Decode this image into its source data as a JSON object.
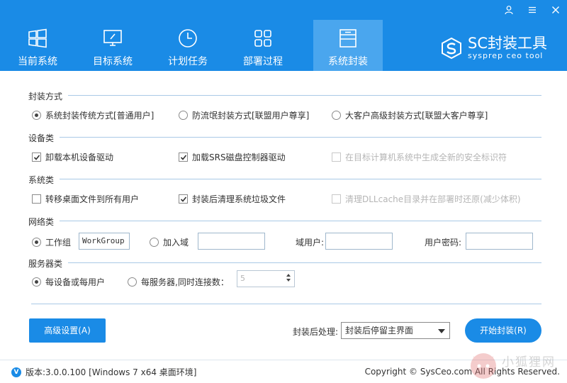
{
  "window": {
    "controls": [
      "user-icon",
      "menu-icon",
      "close-icon"
    ]
  },
  "nav": {
    "items": [
      {
        "label": "当前系统",
        "icon": "windows-icon"
      },
      {
        "label": "目标系统",
        "icon": "monitor-icon"
      },
      {
        "label": "计划任务",
        "icon": "clock-icon"
      },
      {
        "label": "部署过程",
        "icon": "grid-icon"
      },
      {
        "label": "系统封装",
        "icon": "package-icon",
        "active": true
      }
    ]
  },
  "brand": {
    "title": "SC封装工具",
    "subtitle": "sysprep ceo tool"
  },
  "sections": {
    "method": {
      "title": "封装方式",
      "options": [
        "系统封装传统方式[普通用户]",
        "防流氓封装方式[联盟用户尊享]",
        "大客户高级封装方式[联盟大客户尊享]"
      ],
      "selected": 0
    },
    "device": {
      "title": "设备类",
      "options": [
        {
          "label": "卸载本机设备驱动",
          "checked": true,
          "enabled": true
        },
        {
          "label": "加载SRS磁盘控制器驱动",
          "checked": true,
          "enabled": true
        },
        {
          "label": "在目标计算机系统中生成全新的安全标识符",
          "checked": false,
          "enabled": false
        }
      ]
    },
    "system": {
      "title": "系统类",
      "options": [
        {
          "label": "转移桌面文件到所有用户",
          "checked": false,
          "enabled": true
        },
        {
          "label": "封装后清理系统垃圾文件",
          "checked": true,
          "enabled": true
        },
        {
          "label": "清理DLLcache目录并在部署时还原(减少体积)",
          "checked": false,
          "enabled": false
        }
      ]
    },
    "network": {
      "title": "网络类",
      "workgroup_label": "工作组",
      "workgroup_value": "WorkGroup",
      "domain_label": "加入域",
      "domain_value": "",
      "domain_user_label": "域用户:",
      "domain_user_value": "",
      "password_label": "用户密码:",
      "password_value": "",
      "selected": "workgroup"
    },
    "server": {
      "title": "服务器类",
      "per_device_label": "每设备或每用户",
      "per_server_label": "每服务器,同时连接数：",
      "connections": "5",
      "selected": "per_device"
    }
  },
  "actions": {
    "advanced_label": "高级设置(A)",
    "post_label": "封装后处理:",
    "post_value": "封装后停留主界面",
    "start_label": "开始封装(R)"
  },
  "footer": {
    "version": "版本:3.0.0.100 [Windows 7 x64 桌面环境]",
    "copyright": "Copyright © SysCeo.com All Rights Reserved."
  },
  "watermark": {
    "text": "小狐狸网"
  },
  "colors": {
    "header": "#1a8be6",
    "active_tab": "#4aa6ee",
    "accent": "#1a8be6"
  }
}
